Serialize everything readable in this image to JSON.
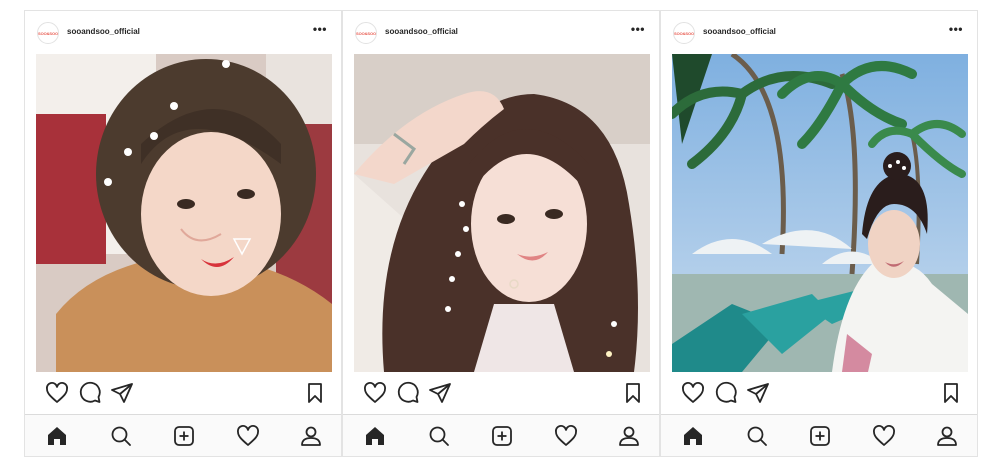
{
  "avatar_logo_text": "SOO&SOO",
  "posts": [
    {
      "username": "sooandsoo_official",
      "more_label": "•••"
    },
    {
      "username": "sooandsoo_official",
      "more_label": "•••"
    },
    {
      "username": "sooandsoo_official",
      "more_label": "•••"
    }
  ],
  "icons": {
    "like": "heart-outline",
    "comment": "comment-bubble",
    "share": "paper-plane",
    "save": "bookmark",
    "home": "home-filled",
    "search": "magnifier",
    "new_post": "plus-square",
    "activity": "heart-outline",
    "profile": "person"
  },
  "colors": {
    "icon": "#262626",
    "border": "#dbdbdb",
    "logo_red": "#e85a4f"
  }
}
